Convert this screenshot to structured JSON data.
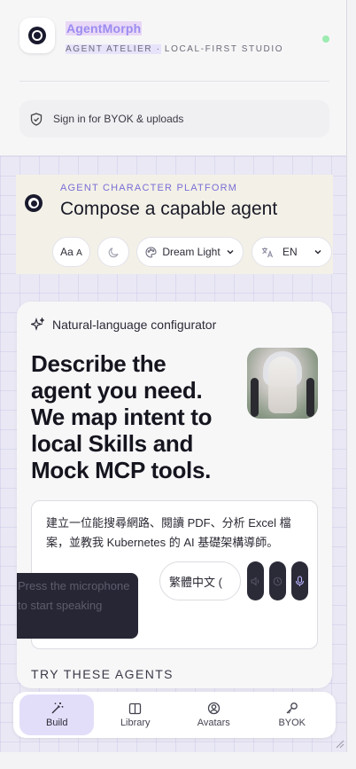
{
  "header": {
    "app_name": "AgentMorph",
    "subtitle_highlighted": "AGENT ATELIER ·",
    "subtitle_rest": " LOCAL-FIRST STUDIO",
    "signin_label": "Sign in for BYOK & uploads"
  },
  "hero": {
    "kicker": "AGENT CHARACTER PLATFORM",
    "title": "Compose a capable agent",
    "font_size_label_main": "Aa",
    "font_size_label_small": "A",
    "theme_label": "Dream Light",
    "language_label": "EN"
  },
  "configurator": {
    "heading": "Natural-language configurator",
    "title_lines": [
      "Describe the",
      "agent you need.",
      "We map intent to",
      "local Skills and",
      "Mock MCP tools."
    ],
    "prompt_value": "建立一位能搜尋網路、閱讀 PDF、分析 Excel 檔案，並教我 Kubernetes 的 AI 基礎架構導師。",
    "mic_tooltip": "Press the microphone to start speaking",
    "speech_language": "繁體中文 (",
    "try_title": "TRY THESE AGENTS"
  },
  "nav": {
    "items": [
      {
        "label": "Build",
        "icon": "wand-icon",
        "active": true
      },
      {
        "label": "Library",
        "icon": "book-icon",
        "active": false
      },
      {
        "label": "Avatars",
        "icon": "user-circle-icon",
        "active": false
      },
      {
        "label": "BYOK",
        "icon": "key-icon",
        "active": false
      }
    ]
  },
  "colors": {
    "accent": "#7a6dd6",
    "active_nav_bg": "#e2def9",
    "status_online": "#9cebb0"
  }
}
